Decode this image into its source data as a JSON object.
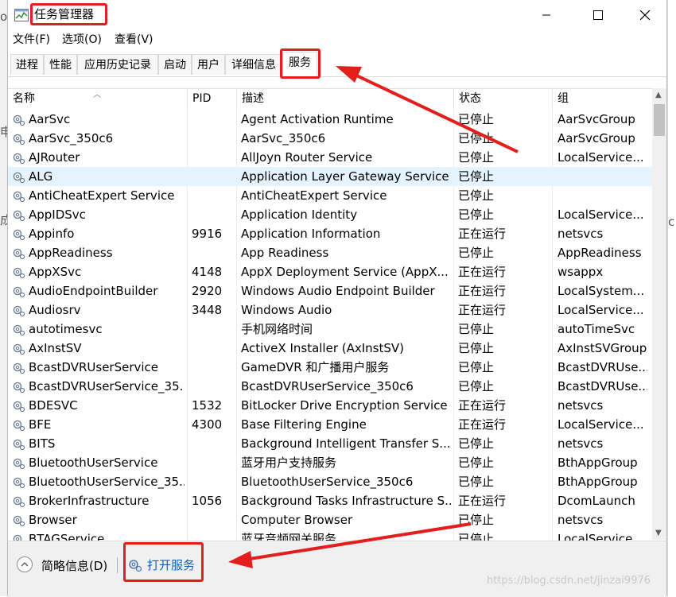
{
  "window": {
    "title": "任务管理器",
    "controls": {
      "minimize": "—",
      "maximize": "☐",
      "close": "✕"
    }
  },
  "background_fragments": [
    "ol",
    "申",
    "成",
    "c"
  ],
  "menu": [
    {
      "label": "文件(F)"
    },
    {
      "label": "选项(O)"
    },
    {
      "label": "查看(V)"
    }
  ],
  "tabs": [
    {
      "label": "进程"
    },
    {
      "label": "性能"
    },
    {
      "label": "应用历史记录"
    },
    {
      "label": "启动"
    },
    {
      "label": "用户"
    },
    {
      "label": "详细信息"
    },
    {
      "label": "服务",
      "active": true
    }
  ],
  "columns": {
    "name": "名称",
    "pid": "PID",
    "desc": "描述",
    "status": "状态",
    "group": "组"
  },
  "rows": [
    {
      "name": "AarSvc",
      "pid": "",
      "desc": "Agent Activation Runtime",
      "status": "已停止",
      "group": "AarSvcGroup"
    },
    {
      "name": "AarSvc_350c6",
      "pid": "",
      "desc": "AarSvc_350c6",
      "status": "已停止",
      "group": "AarSvcGroup"
    },
    {
      "name": "AJRouter",
      "pid": "",
      "desc": "AllJoyn Router Service",
      "status": "已停止",
      "group": "LocalService..."
    },
    {
      "name": "ALG",
      "pid": "",
      "desc": "Application Layer Gateway Service",
      "status": "已停止",
      "group": "",
      "selected": true
    },
    {
      "name": "AntiCheatExpert Service",
      "pid": "",
      "desc": "AntiCheatExpert Service",
      "status": "已停止",
      "group": ""
    },
    {
      "name": "AppIDSvc",
      "pid": "",
      "desc": "Application Identity",
      "status": "已停止",
      "group": "LocalService..."
    },
    {
      "name": "Appinfo",
      "pid": "9916",
      "desc": "Application Information",
      "status": "正在运行",
      "group": "netsvcs"
    },
    {
      "name": "AppReadiness",
      "pid": "",
      "desc": "App Readiness",
      "status": "已停止",
      "group": "AppReadiness"
    },
    {
      "name": "AppXSvc",
      "pid": "4148",
      "desc": "AppX Deployment Service (AppX...",
      "status": "正在运行",
      "group": "wsappx"
    },
    {
      "name": "AudioEndpointBuilder",
      "pid": "2920",
      "desc": "Windows Audio Endpoint Builder",
      "status": "正在运行",
      "group": "LocalSystem..."
    },
    {
      "name": "Audiosrv",
      "pid": "3448",
      "desc": "Windows Audio",
      "status": "正在运行",
      "group": "LocalService..."
    },
    {
      "name": "autotimesvc",
      "pid": "",
      "desc": "手机网络时间",
      "status": "已停止",
      "group": "autoTimeSvc"
    },
    {
      "name": "AxInstSV",
      "pid": "",
      "desc": "ActiveX Installer (AxInstSV)",
      "status": "已停止",
      "group": "AxInstSVGroup"
    },
    {
      "name": "BcastDVRUserService",
      "pid": "",
      "desc": "GameDVR 和广播用户服务",
      "status": "已停止",
      "group": "BcastDVRUse..."
    },
    {
      "name": "BcastDVRUserService_35...",
      "pid": "",
      "desc": "BcastDVRUserService_350c6",
      "status": "已停止",
      "group": "BcastDVRUse..."
    },
    {
      "name": "BDESVC",
      "pid": "1532",
      "desc": "BitLocker Drive Encryption Service",
      "status": "正在运行",
      "group": "netsvcs"
    },
    {
      "name": "BFE",
      "pid": "4300",
      "desc": "Base Filtering Engine",
      "status": "正在运行",
      "group": "LocalService..."
    },
    {
      "name": "BITS",
      "pid": "",
      "desc": "Background Intelligent Transfer S...",
      "status": "已停止",
      "group": "netsvcs"
    },
    {
      "name": "BluetoothUserService",
      "pid": "",
      "desc": "蓝牙用户支持服务",
      "status": "已停止",
      "group": "BthAppGroup"
    },
    {
      "name": "BluetoothUserService_35...",
      "pid": "",
      "desc": "BluetoothUserService_350c6",
      "status": "已停止",
      "group": "BthAppGroup"
    },
    {
      "name": "BrokerInfrastructure",
      "pid": "1056",
      "desc": "Background Tasks Infrastructure S...",
      "status": "正在运行",
      "group": "DcomLaunch"
    },
    {
      "name": "Browser",
      "pid": "",
      "desc": "Computer Browser",
      "status": "已停止",
      "group": "netsvcs"
    },
    {
      "name": "BTAGService",
      "pid": "",
      "desc": "蓝牙音频网关服务",
      "status": "已停止",
      "group": "LocalService..."
    }
  ],
  "footer": {
    "fewer_details": "简略信息(D)",
    "open_services": "打开服务"
  },
  "watermark": "https://blog.csdn.net/jinzai9976",
  "colors": {
    "annotation_red": "#e41d1d",
    "selected_row": "#e5f3ff",
    "link_blue": "#1a5fb4"
  }
}
